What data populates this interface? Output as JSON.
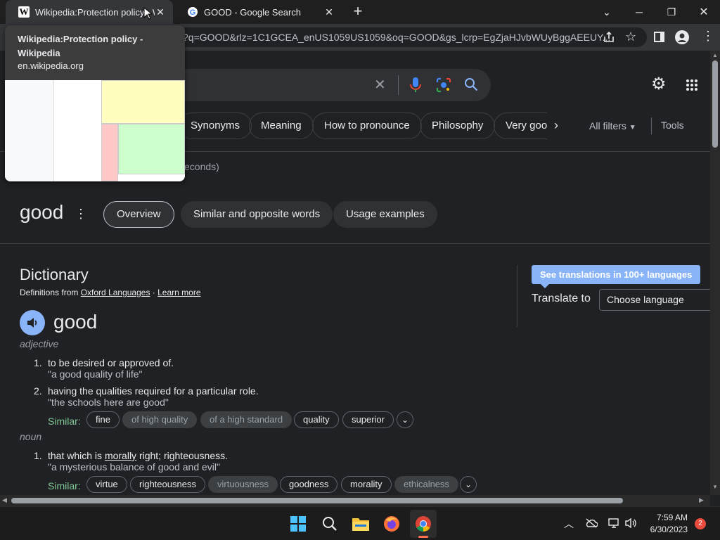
{
  "tabs": [
    {
      "title": "Wikipedia:Protection policy - Wi",
      "favicon": "W"
    },
    {
      "title": "GOOD - Google Search"
    }
  ],
  "omnibox": {
    "url": "?q=GOOD&rlz=1C1GCEA_enUS1059US1059&oq=GOOD&gs_lcrp=EgZjaHJvbWUyBggAEEUY..."
  },
  "hover_card": {
    "title": "Wikipedia:Protection policy - Wikipedia",
    "domain": "en.wikipedia.org"
  },
  "search": {
    "chips": [
      "Synonyms",
      "Meaning",
      "How to pronounce",
      "Philosophy",
      "Very goo"
    ],
    "all_filters": "All filters",
    "tools": "Tools",
    "result_stats": "econds)"
  },
  "term_bar": {
    "word": "good",
    "tabs": [
      "Overview",
      "Similar and opposite words",
      "Usage examples"
    ]
  },
  "dictionary": {
    "heading": "Dictionary",
    "source_prefix": "Definitions from ",
    "source_link": "Oxford Languages",
    "separator": " · ",
    "learn_more": "Learn more",
    "word": "good",
    "adjective_label": "adjective",
    "adj_defs": [
      {
        "num": "1.",
        "text": "to be desired or approved of.",
        "example": "\"a good quality of life\""
      },
      {
        "num": "2.",
        "text": "having the qualities required for a particular role.",
        "example": "\"the schools here are good\""
      }
    ],
    "similar_label": "Similar:",
    "adj_similar": [
      "fine",
      "of high quality",
      "of a high standard",
      "quality",
      "superior"
    ],
    "noun_label": "noun",
    "noun_defs": [
      {
        "num": "1.",
        "text_before": "that which is ",
        "text_link": "morally",
        "text_after": " right; righteousness.",
        "example": "\"a mysterious balance of good and evil\""
      }
    ],
    "noun_similar": [
      "virtue",
      "righteousness",
      "virtuousness",
      "goodness",
      "morality",
      "ethicalness"
    ]
  },
  "translate": {
    "tooltip": "See translations in 100+ languages",
    "label": "Translate to",
    "select_placeholder": "Choose language"
  },
  "taskbar": {
    "time": "7:59 AM",
    "date": "6/30/2023",
    "badge": "2"
  },
  "colors": {
    "accent": "#8ab4f8",
    "similar_green": "#81c995",
    "tooltip_bg": "#8ab4f8"
  }
}
